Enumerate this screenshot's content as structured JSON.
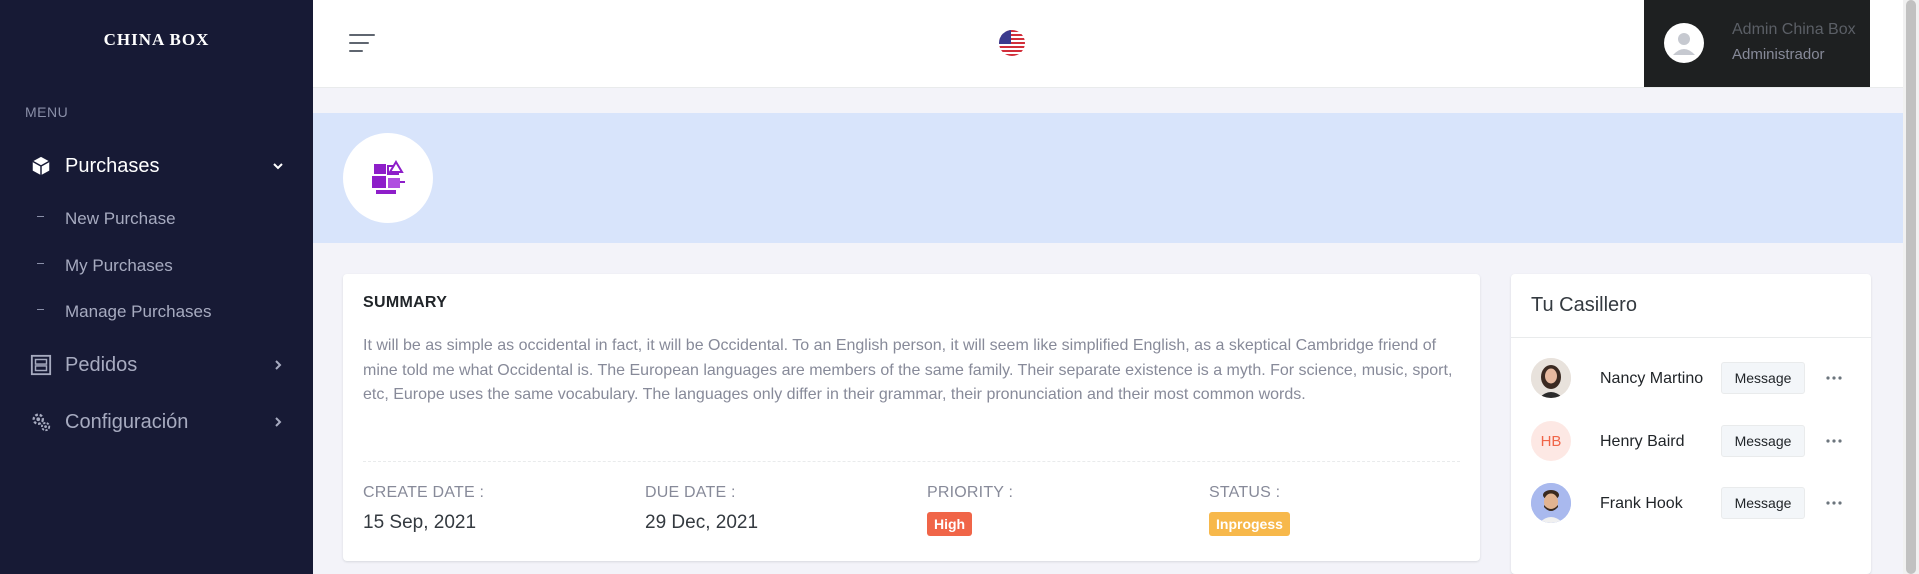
{
  "sidebar": {
    "brand": "CHINA BOX",
    "menu_title": "MENU",
    "items": [
      {
        "label": "Purchases",
        "icon": "cube-icon",
        "active": true
      },
      {
        "label": "Pedidos",
        "icon": "list-box-icon",
        "active": false
      },
      {
        "label": "Configuración",
        "icon": "cogs-icon",
        "active": false
      }
    ],
    "sub_items": [
      {
        "label": "New Purchase"
      },
      {
        "label": "My Purchases"
      },
      {
        "label": "Manage Purchases"
      }
    ]
  },
  "topbar": {
    "user_name": "Admin China Box",
    "user_role": "Administrador",
    "language_icon": "us-flag-icon"
  },
  "summary": {
    "title": "SUMMARY",
    "text": "It will be as simple as occidental in fact, it will be Occidental. To an English person, it will seem like simplified English, as a skeptical Cambridge friend of mine told me what Occidental is. The European languages are members of the same family. Their separate existence is a myth. For science, music, sport, etc, Europe uses the same vocabulary. The languages only differ in their grammar, their pronunciation and their most common words.",
    "create_date_label": "CREATE DATE :",
    "create_date": "15 Sep, 2021",
    "due_date_label": "DUE DATE :",
    "due_date": "29 Dec, 2021",
    "priority_label": "PRIORITY :",
    "priority": "High",
    "status_label": "STATUS :",
    "status": "Inprogess"
  },
  "casillero": {
    "title": "Tu Casillero",
    "members": [
      {
        "name": "Nancy Martino",
        "initials": "",
        "button": "Message"
      },
      {
        "name": "Henry Baird",
        "initials": "HB",
        "button": "Message"
      },
      {
        "name": "Frank Hook",
        "initials": "",
        "button": "Message"
      }
    ]
  },
  "colors": {
    "sidebar_bg": "#171a35",
    "banner_bg": "#d8e4fb",
    "priority_badge": "#f06548",
    "status_badge": "#f7b84b",
    "project_icon": "#8e1ec9"
  }
}
